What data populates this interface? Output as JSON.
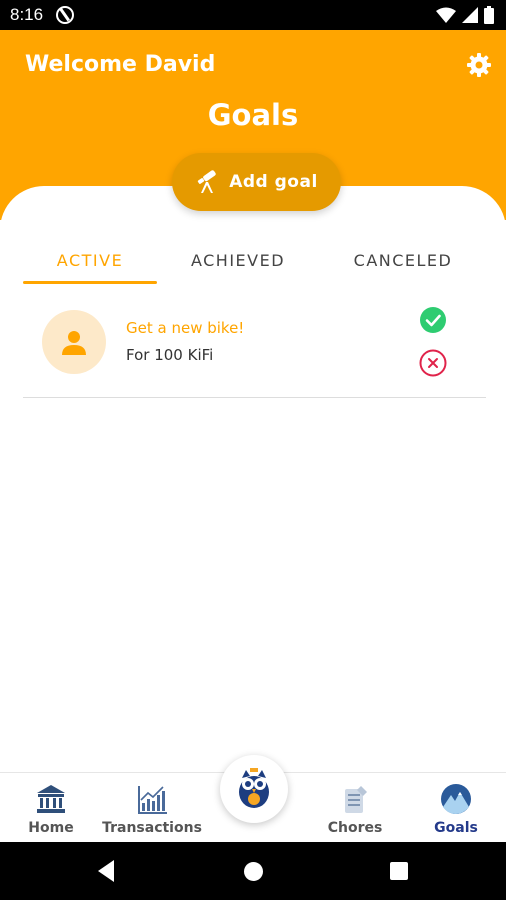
{
  "status_bar": {
    "time": "8:16"
  },
  "header": {
    "welcome": "Welcome David",
    "title": "Goals"
  },
  "add_goal": {
    "label": "Add goal"
  },
  "tabs": [
    {
      "label": "ACTIVE",
      "active": true
    },
    {
      "label": "ACHIEVED",
      "active": false
    },
    {
      "label": "CANCELED",
      "active": false
    }
  ],
  "goals": [
    {
      "name": "Get a new bike!",
      "amount": "For 100 KiFi"
    }
  ],
  "bottom_nav": [
    {
      "label": "Home",
      "icon": "bank-icon"
    },
    {
      "label": "Transactions",
      "icon": "chart-icon"
    },
    {
      "label": "Chores",
      "icon": "chores-icon"
    },
    {
      "label": "Goals",
      "icon": "goals-icon",
      "active": true
    }
  ],
  "colors": {
    "accent": "#ffa500",
    "accent_dark": "#e59a00",
    "success": "#2ecc71",
    "danger": "#e0234a",
    "nav_active": "#243a8a"
  }
}
